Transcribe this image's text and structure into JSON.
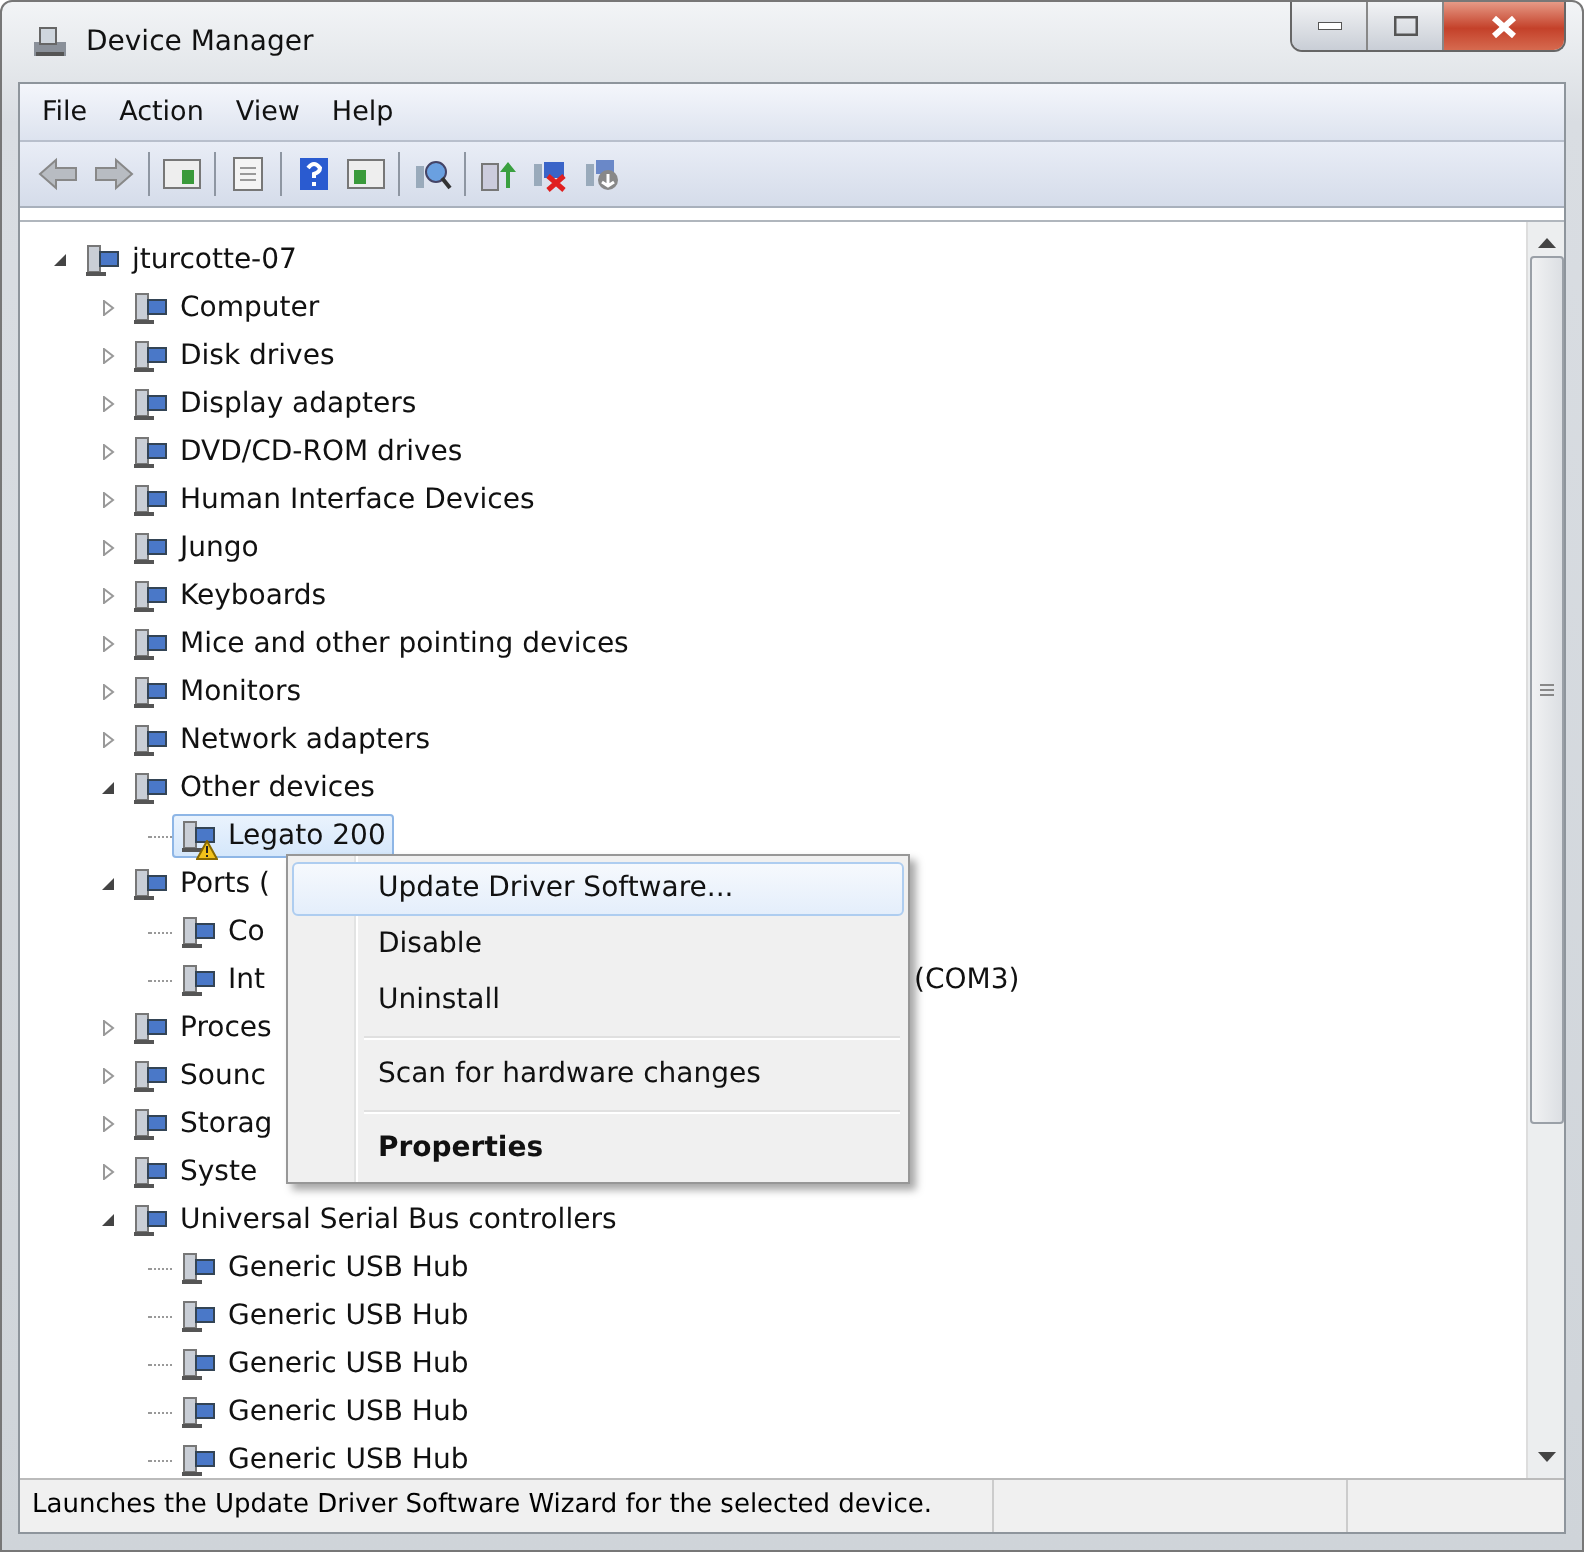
{
  "window": {
    "title": "Device Manager"
  },
  "menu": [
    "File",
    "Action",
    "View",
    "Help"
  ],
  "tree": {
    "label": "jturcotte-07",
    "expanded": true,
    "selected": false,
    "children": [
      {
        "label": "Computer",
        "expanded": false,
        "selected": false
      },
      {
        "label": "Disk drives",
        "expanded": false,
        "selected": false
      },
      {
        "label": "Display adapters",
        "expanded": false,
        "selected": false
      },
      {
        "label": "DVD/CD-ROM drives",
        "expanded": false,
        "selected": false
      },
      {
        "label": "Human Interface Devices",
        "expanded": false,
        "selected": false
      },
      {
        "label": "Jungo",
        "expanded": false,
        "selected": false
      },
      {
        "label": "Keyboards",
        "expanded": false,
        "selected": false
      },
      {
        "label": "Mice and other pointing devices",
        "expanded": false,
        "selected": false
      },
      {
        "label": "Monitors",
        "expanded": false,
        "selected": false
      },
      {
        "label": "Network adapters",
        "expanded": false,
        "selected": false
      },
      {
        "label": "Other devices",
        "expanded": true,
        "selected": false,
        "children": [
          {
            "label": "Legato 200",
            "selected": true,
            "warning": true
          }
        ]
      },
      {
        "label": "Ports (",
        "expanded": true,
        "selected": false,
        "children": [
          {
            "label": "Co",
            "selected": false
          },
          {
            "label": "Int",
            "selected": false,
            "tail": "(COM3)"
          }
        ]
      },
      {
        "label": "Proces",
        "expanded": false,
        "selected": false
      },
      {
        "label": "Sounc",
        "expanded": false,
        "selected": false
      },
      {
        "label": "Storag",
        "expanded": false,
        "selected": false
      },
      {
        "label": "Syste",
        "expanded": false,
        "selected": false
      },
      {
        "label": "Universal Serial Bus controllers",
        "expanded": true,
        "selected": false,
        "children": [
          {
            "label": "Generic USB Hub",
            "selected": false
          },
          {
            "label": "Generic USB Hub",
            "selected": false
          },
          {
            "label": "Generic USB Hub",
            "selected": false
          },
          {
            "label": "Generic USB Hub",
            "selected": false
          },
          {
            "label": "Generic USB Hub",
            "selected": false
          }
        ]
      }
    ]
  },
  "context_menu": {
    "items": [
      {
        "kind": "item",
        "label": "Update Driver Software...",
        "selected": true,
        "default": false
      },
      {
        "kind": "item",
        "label": "Disable",
        "selected": false,
        "default": false
      },
      {
        "kind": "item",
        "label": "Uninstall",
        "selected": false,
        "default": false
      },
      {
        "kind": "separator"
      },
      {
        "kind": "item",
        "label": "Scan for hardware changes",
        "selected": false,
        "default": false
      },
      {
        "kind": "separator"
      },
      {
        "kind": "item",
        "label": "Properties",
        "selected": false,
        "default": true
      }
    ]
  },
  "status_bar": {
    "text": "Launches the Update Driver Software Wizard for the selected device."
  }
}
